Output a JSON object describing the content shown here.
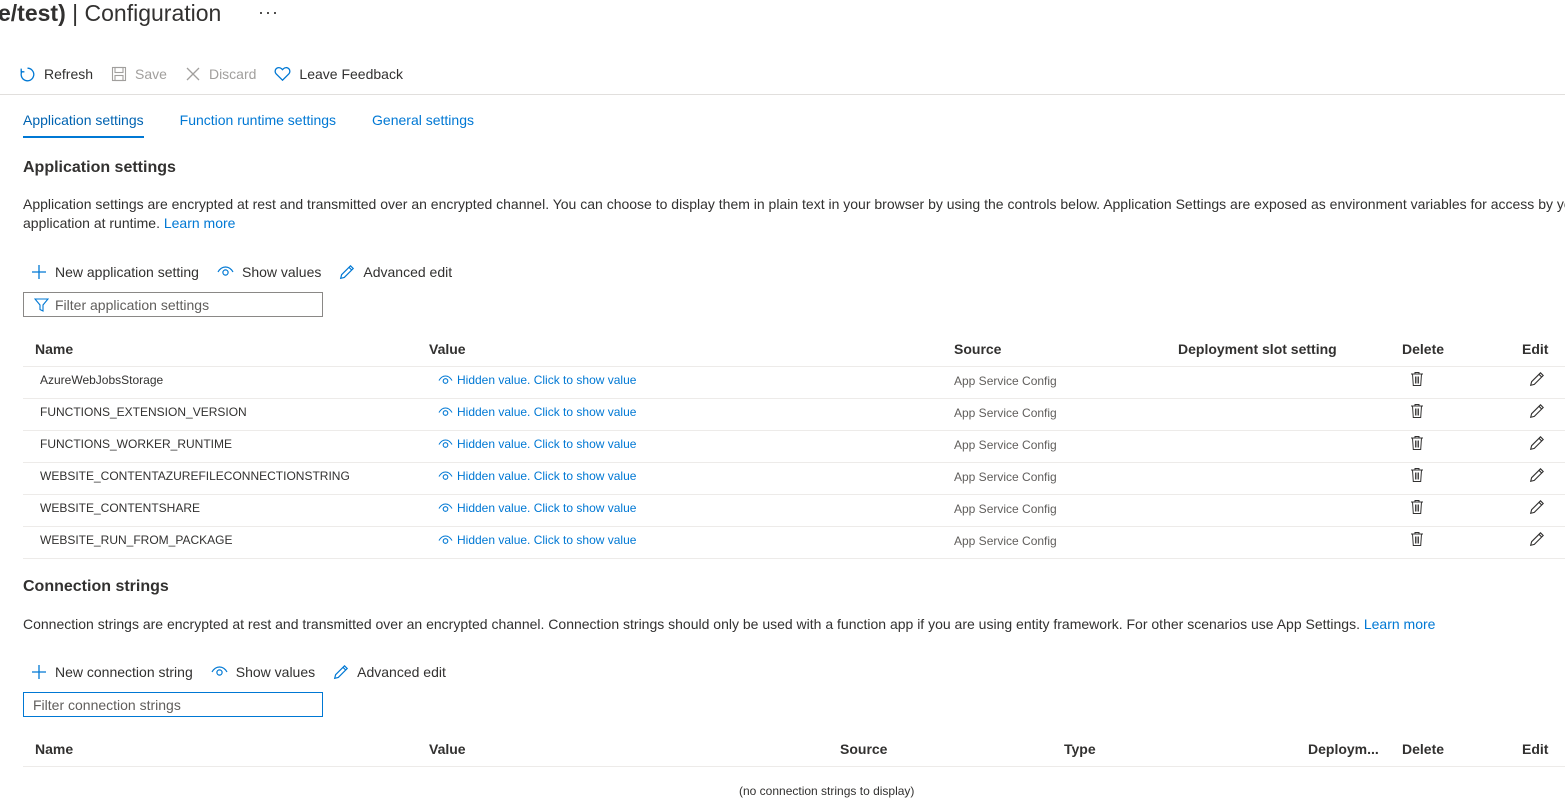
{
  "header": {
    "title_bold": "e/test)",
    "title_sep": " | ",
    "title_rest": "Configuration",
    "more": "···"
  },
  "toolbar": {
    "refresh": "Refresh",
    "save": "Save",
    "discard": "Discard",
    "feedback": "Leave Feedback"
  },
  "tabs": [
    "Application settings",
    "Function runtime settings",
    "General settings"
  ],
  "app_settings": {
    "title": "Application settings",
    "desc_line1": "Application settings are encrypted at rest and transmitted over an encrypted channel. You can choose to display them in plain text in your browser by using the controls below. Application Settings are exposed as environment variables for access by yo",
    "desc_line2": "application at runtime.",
    "learn_more": "Learn more",
    "cmd_new": "New application setting",
    "cmd_show": "Show values",
    "cmd_adv": "Advanced edit",
    "filter_placeholder": "Filter application settings",
    "columns": [
      "Name",
      "Value",
      "Source",
      "Deployment slot setting",
      "Delete",
      "Edit"
    ],
    "hidden_value_text": "Hidden value. Click to show value",
    "rows": [
      {
        "name": "AzureWebJobsStorage",
        "source": "App Service Config"
      },
      {
        "name": "FUNCTIONS_EXTENSION_VERSION",
        "source": "App Service Config"
      },
      {
        "name": "FUNCTIONS_WORKER_RUNTIME",
        "source": "App Service Config"
      },
      {
        "name": "WEBSITE_CONTENTAZUREFILECONNECTIONSTRING",
        "source": "App Service Config"
      },
      {
        "name": "WEBSITE_CONTENTSHARE",
        "source": "App Service Config"
      },
      {
        "name": "WEBSITE_RUN_FROM_PACKAGE",
        "source": "App Service Config"
      }
    ]
  },
  "conn_strings": {
    "title": "Connection strings",
    "desc": "Connection strings are encrypted at rest and transmitted over an encrypted channel. Connection strings should only be used with a function app if you are using entity framework. For other scenarios use App Settings.",
    "learn_more": "Learn more",
    "cmd_new": "New connection string",
    "cmd_show": "Show values",
    "cmd_adv": "Advanced edit",
    "filter_placeholder": "Filter connection strings",
    "columns": [
      "Name",
      "Value",
      "Source",
      "Type",
      "Deploym...",
      "Delete",
      "Edit"
    ],
    "empty": "(no connection strings to display)"
  },
  "colors": {
    "accent": "#0078d4",
    "text": "#323130",
    "disabled": "#a19f9d",
    "border": "#edebe9"
  }
}
